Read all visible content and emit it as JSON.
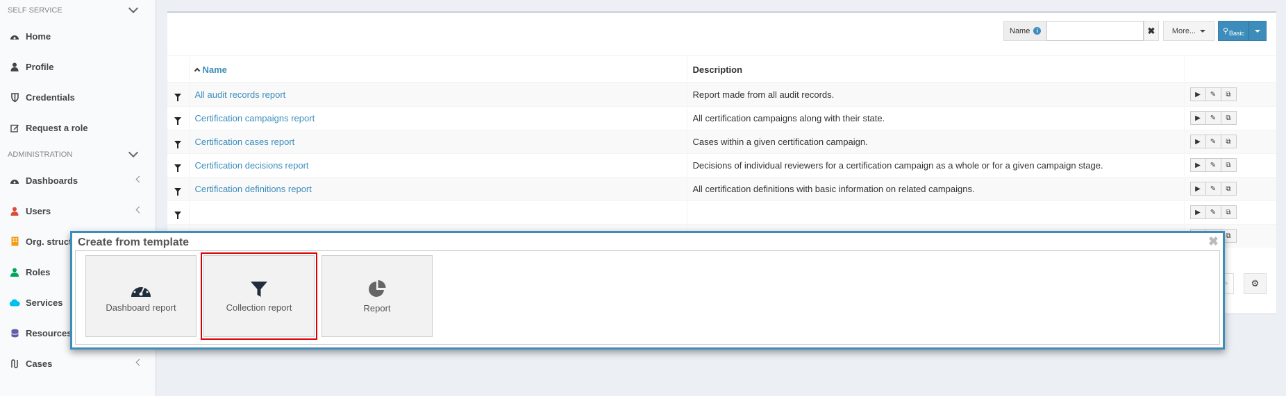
{
  "sidebar": {
    "self_service_header": "SELF SERVICE",
    "self_service": [
      {
        "label": "Home",
        "icon": "dashboard-icon"
      },
      {
        "label": "Profile",
        "icon": "user-icon"
      },
      {
        "label": "Credentials",
        "icon": "shield-icon"
      },
      {
        "label": "Request a role",
        "icon": "edit-icon"
      }
    ],
    "admin_header": "ADMINISTRATION",
    "admin": [
      {
        "label": "Dashboards",
        "icon": "dashboard-icon"
      },
      {
        "label": "Users",
        "icon": "user-icon"
      },
      {
        "label": "Org. struct",
        "icon": "building-icon"
      },
      {
        "label": "Roles",
        "icon": "role-icon"
      },
      {
        "label": "Services",
        "icon": "cloud-icon"
      },
      {
        "label": "Resources",
        "icon": "database-icon"
      },
      {
        "label": "Cases",
        "icon": "cases-icon"
      }
    ]
  },
  "toolbar": {
    "name_label": "Name",
    "name_value": "",
    "more_label": "More...",
    "basic_label": "Basic"
  },
  "table": {
    "col_name": "Name",
    "col_description": "Description",
    "rows": [
      {
        "name": "All audit records report",
        "description": "Report made from all audit records."
      },
      {
        "name": "Certification campaigns report",
        "description": "All certification campaigns along with their state."
      },
      {
        "name": "Certification cases report",
        "description": "Cases within a given certification campaign."
      },
      {
        "name": "Certification decisions report",
        "description": "Decisions of individual reviewers for a certification campaign as a whole or for a given campaign stage."
      },
      {
        "name": "Certification definitions report",
        "description": "All certification definitions with basic information on related campaigns."
      }
    ]
  },
  "pager": {
    "next_label": ">>"
  },
  "modal": {
    "title": "Create from template",
    "templates": [
      {
        "label": "Dashboard report",
        "icon": "dashboard-icon"
      },
      {
        "label": "Collection report",
        "icon": "funnel-icon",
        "selected": true
      },
      {
        "label": "Report",
        "icon": "pie-chart-icon"
      }
    ]
  },
  "colors": {
    "accent": "#3c8dbc",
    "selection": "#d00000"
  }
}
